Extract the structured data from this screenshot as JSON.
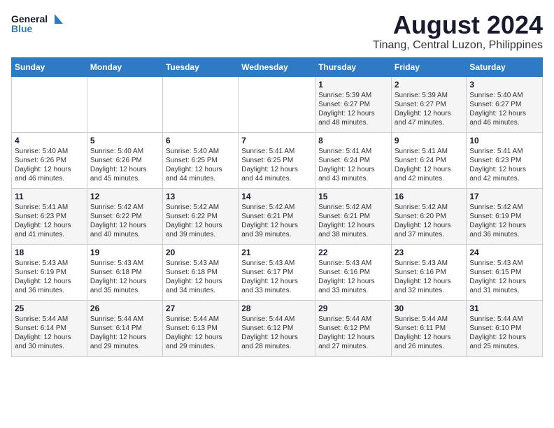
{
  "logo": {
    "line1": "General",
    "line2": "Blue"
  },
  "title": {
    "month_year": "August 2024",
    "location": "Tinang, Central Luzon, Philippines"
  },
  "days_of_week": [
    "Sunday",
    "Monday",
    "Tuesday",
    "Wednesday",
    "Thursday",
    "Friday",
    "Saturday"
  ],
  "weeks": [
    [
      {
        "day": "",
        "info": ""
      },
      {
        "day": "",
        "info": ""
      },
      {
        "day": "",
        "info": ""
      },
      {
        "day": "",
        "info": ""
      },
      {
        "day": "1",
        "info": "Sunrise: 5:39 AM\nSunset: 6:27 PM\nDaylight: 12 hours\nand 48 minutes."
      },
      {
        "day": "2",
        "info": "Sunrise: 5:39 AM\nSunset: 6:27 PM\nDaylight: 12 hours\nand 47 minutes."
      },
      {
        "day": "3",
        "info": "Sunrise: 5:40 AM\nSunset: 6:27 PM\nDaylight: 12 hours\nand 46 minutes."
      }
    ],
    [
      {
        "day": "4",
        "info": "Sunrise: 5:40 AM\nSunset: 6:26 PM\nDaylight: 12 hours\nand 46 minutes."
      },
      {
        "day": "5",
        "info": "Sunrise: 5:40 AM\nSunset: 6:26 PM\nDaylight: 12 hours\nand 45 minutes."
      },
      {
        "day": "6",
        "info": "Sunrise: 5:40 AM\nSunset: 6:25 PM\nDaylight: 12 hours\nand 44 minutes."
      },
      {
        "day": "7",
        "info": "Sunrise: 5:41 AM\nSunset: 6:25 PM\nDaylight: 12 hours\nand 44 minutes."
      },
      {
        "day": "8",
        "info": "Sunrise: 5:41 AM\nSunset: 6:24 PM\nDaylight: 12 hours\nand 43 minutes."
      },
      {
        "day": "9",
        "info": "Sunrise: 5:41 AM\nSunset: 6:24 PM\nDaylight: 12 hours\nand 42 minutes."
      },
      {
        "day": "10",
        "info": "Sunrise: 5:41 AM\nSunset: 6:23 PM\nDaylight: 12 hours\nand 42 minutes."
      }
    ],
    [
      {
        "day": "11",
        "info": "Sunrise: 5:41 AM\nSunset: 6:23 PM\nDaylight: 12 hours\nand 41 minutes."
      },
      {
        "day": "12",
        "info": "Sunrise: 5:42 AM\nSunset: 6:22 PM\nDaylight: 12 hours\nand 40 minutes."
      },
      {
        "day": "13",
        "info": "Sunrise: 5:42 AM\nSunset: 6:22 PM\nDaylight: 12 hours\nand 39 minutes."
      },
      {
        "day": "14",
        "info": "Sunrise: 5:42 AM\nSunset: 6:21 PM\nDaylight: 12 hours\nand 39 minutes."
      },
      {
        "day": "15",
        "info": "Sunrise: 5:42 AM\nSunset: 6:21 PM\nDaylight: 12 hours\nand 38 minutes."
      },
      {
        "day": "16",
        "info": "Sunrise: 5:42 AM\nSunset: 6:20 PM\nDaylight: 12 hours\nand 37 minutes."
      },
      {
        "day": "17",
        "info": "Sunrise: 5:42 AM\nSunset: 6:19 PM\nDaylight: 12 hours\nand 36 minutes."
      }
    ],
    [
      {
        "day": "18",
        "info": "Sunrise: 5:43 AM\nSunset: 6:19 PM\nDaylight: 12 hours\nand 36 minutes."
      },
      {
        "day": "19",
        "info": "Sunrise: 5:43 AM\nSunset: 6:18 PM\nDaylight: 12 hours\nand 35 minutes."
      },
      {
        "day": "20",
        "info": "Sunrise: 5:43 AM\nSunset: 6:18 PM\nDaylight: 12 hours\nand 34 minutes."
      },
      {
        "day": "21",
        "info": "Sunrise: 5:43 AM\nSunset: 6:17 PM\nDaylight: 12 hours\nand 33 minutes."
      },
      {
        "day": "22",
        "info": "Sunrise: 5:43 AM\nSunset: 6:16 PM\nDaylight: 12 hours\nand 33 minutes."
      },
      {
        "day": "23",
        "info": "Sunrise: 5:43 AM\nSunset: 6:16 PM\nDaylight: 12 hours\nand 32 minutes."
      },
      {
        "day": "24",
        "info": "Sunrise: 5:43 AM\nSunset: 6:15 PM\nDaylight: 12 hours\nand 31 minutes."
      }
    ],
    [
      {
        "day": "25",
        "info": "Sunrise: 5:44 AM\nSunset: 6:14 PM\nDaylight: 12 hours\nand 30 minutes."
      },
      {
        "day": "26",
        "info": "Sunrise: 5:44 AM\nSunset: 6:14 PM\nDaylight: 12 hours\nand 29 minutes."
      },
      {
        "day": "27",
        "info": "Sunrise: 5:44 AM\nSunset: 6:13 PM\nDaylight: 12 hours\nand 29 minutes."
      },
      {
        "day": "28",
        "info": "Sunrise: 5:44 AM\nSunset: 6:12 PM\nDaylight: 12 hours\nand 28 minutes."
      },
      {
        "day": "29",
        "info": "Sunrise: 5:44 AM\nSunset: 6:12 PM\nDaylight: 12 hours\nand 27 minutes."
      },
      {
        "day": "30",
        "info": "Sunrise: 5:44 AM\nSunset: 6:11 PM\nDaylight: 12 hours\nand 26 minutes."
      },
      {
        "day": "31",
        "info": "Sunrise: 5:44 AM\nSunset: 6:10 PM\nDaylight: 12 hours\nand 25 minutes."
      }
    ]
  ]
}
